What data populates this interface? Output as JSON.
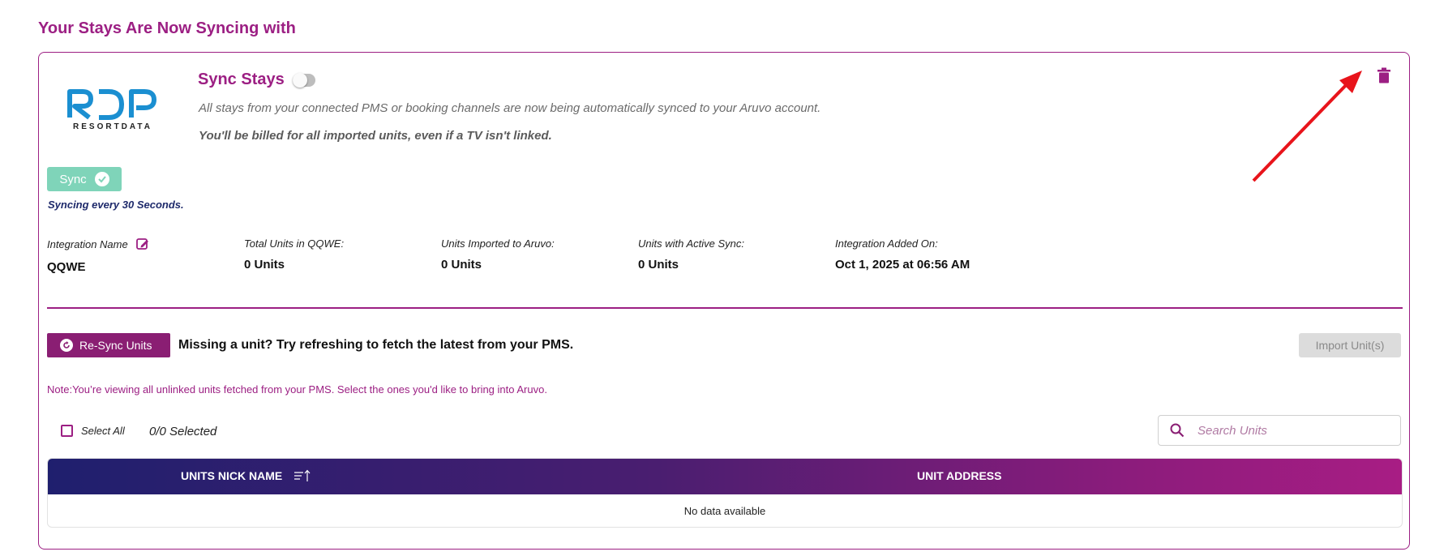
{
  "header": {
    "title": "Your Stays Are Now Syncing with"
  },
  "integration": {
    "logo_sub": "RESORTDATA",
    "sync_button_label": "Sync",
    "sync_interval_text": "Syncing every 30 Seconds.",
    "sync_stays_title": "Sync Stays",
    "sync_stays_enabled": false,
    "description": "All stays from your connected PMS or booking channels are now being automatically synced to your Aruvo account.",
    "billing_note": "You'll be billed for all imported units, even if a TV isn't linked."
  },
  "stats": [
    {
      "label": "Integration Name",
      "value": "QQWE"
    },
    {
      "label": "Total Units in QQWE:",
      "value": "0 Units"
    },
    {
      "label": "Units Imported to Aruvo:",
      "value": "0 Units"
    },
    {
      "label": "Units with Active Sync:",
      "value": "0 Units"
    },
    {
      "label": "Integration Added On:",
      "value": "Oct 1, 2025 at 06:56 AM"
    }
  ],
  "units": {
    "resync_label": "Re-Sync Units",
    "missing_text": "Missing a unit? Try refreshing to fetch the latest from your PMS.",
    "import_label": "Import Unit(s)",
    "note": "Note:You’re viewing all unlinked units fetched from your PMS. Select the ones you'd like to bring into Aruvo.",
    "select_all_label": "Select All",
    "selected_count": "0/0 Selected",
    "search_placeholder": "Search Units",
    "columns": [
      "UNITS NICK NAME",
      "UNIT ADDRESS"
    ],
    "empty_text": "No data available"
  },
  "colors": {
    "brand": "#9c1f83",
    "sync_green": "#7fd4b9",
    "logo_blue": "#1b8fd1"
  }
}
